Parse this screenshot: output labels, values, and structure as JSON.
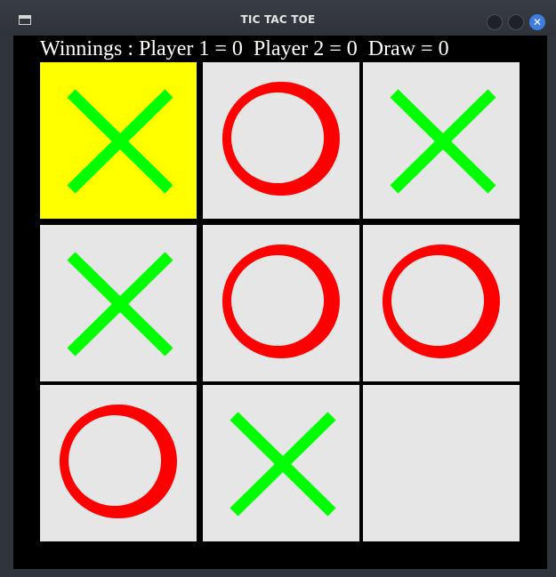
{
  "window": {
    "title": "TIC TAC TOE"
  },
  "game": {
    "status_text": "Winnings : Player 1 = 0  Player 2 = 0  Draw = 0",
    "highlight_color": "#ffff00",
    "x_color": "#00ff00",
    "o_color": "#ff0000",
    "board": [
      [
        "X",
        "O",
        "X"
      ],
      [
        "X",
        "O",
        "O"
      ],
      [
        "O",
        "X",
        ""
      ]
    ],
    "highlighted_cells": [
      [
        0,
        0
      ]
    ]
  }
}
